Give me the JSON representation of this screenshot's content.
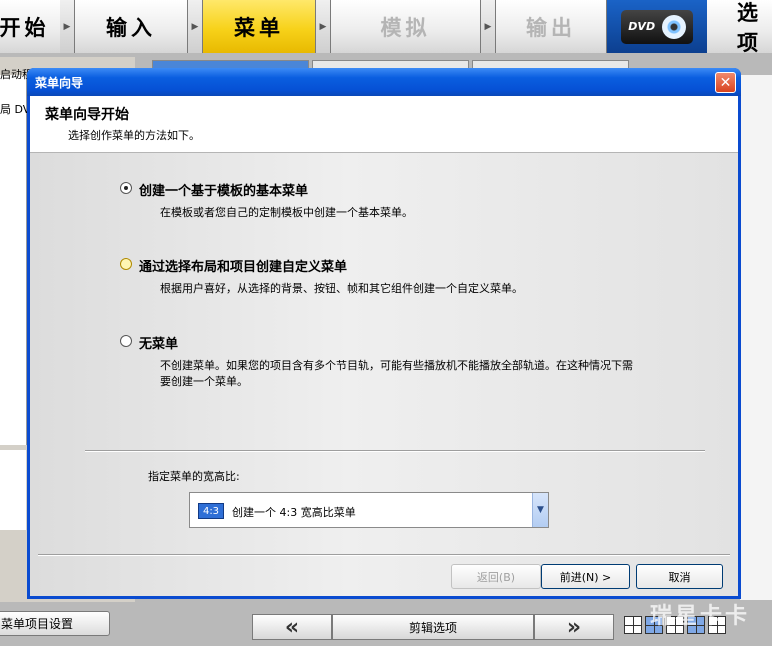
{
  "steps": {
    "start": "开始",
    "input": "输入",
    "menu": "菜单",
    "simulate": "模拟",
    "output": "输出",
    "dvd_logo": "DVD",
    "options": "选项"
  },
  "left_panel": {
    "text1": "启动程",
    "text2": "局 DVD",
    "menu_settings_button": "菜单项目设置"
  },
  "bottom_bar": {
    "prev": "«",
    "edit_options": "剪辑选项",
    "next": "»"
  },
  "watermark": "瑞星卡卡",
  "dialog": {
    "title": "菜单向导",
    "close": "✕",
    "header_title": "菜单向导开始",
    "header_subtitle": "选择创作菜单的方法如下。",
    "options": [
      {
        "label": "创建一个基于模板的基本菜单",
        "description": "在模板或者您自己的定制模板中创建一个基本菜单。",
        "selected": true
      },
      {
        "label": "通过选择布局和项目创建自定义菜单",
        "description": "根据用户喜好，从选择的背景、按钮、帧和其它组件创建一个自定义菜单。",
        "selected": false
      },
      {
        "label": "无菜单",
        "description": "不创建菜单。如果您的项目含有多个节目轨，可能有些播放机不能播放全部轨道。在这种情况下需要创建一个菜单。",
        "selected": false
      }
    ],
    "aspect_label": "指定菜单的宽高比:",
    "aspect_select": {
      "icon_text": "4:3",
      "value": "创建一个 4:3 宽高比菜单"
    },
    "buttons": {
      "back": "返回(B)",
      "next": "前进(N) >",
      "cancel": "取消"
    }
  }
}
